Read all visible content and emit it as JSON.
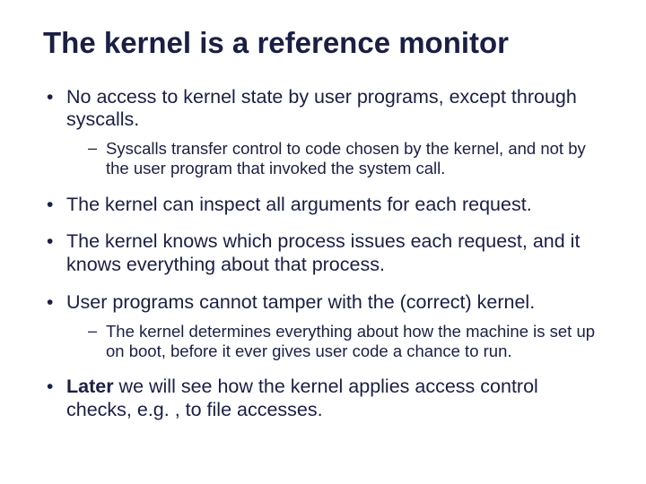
{
  "title": "The kernel is a reference monitor",
  "bullets": {
    "b1": {
      "text": "No access to kernel state by user programs, except through syscalls.",
      "sub1": "Syscalls transfer control to code chosen by the kernel, and not by the user program that invoked the system call."
    },
    "b2": {
      "text": "The kernel can inspect all arguments for each request."
    },
    "b3": {
      "text": "The kernel knows which process issues each request, and it knows everything about that process."
    },
    "b4": {
      "text": "User programs cannot tamper with the (correct) kernel.",
      "sub1": "The kernel determines everything about how the machine is set up on boot, before it ever gives user code a chance to run."
    },
    "b5": {
      "lead": "Later",
      "rest": " we will see how the kernel applies access control checks, e.g. , to file accesses."
    }
  }
}
